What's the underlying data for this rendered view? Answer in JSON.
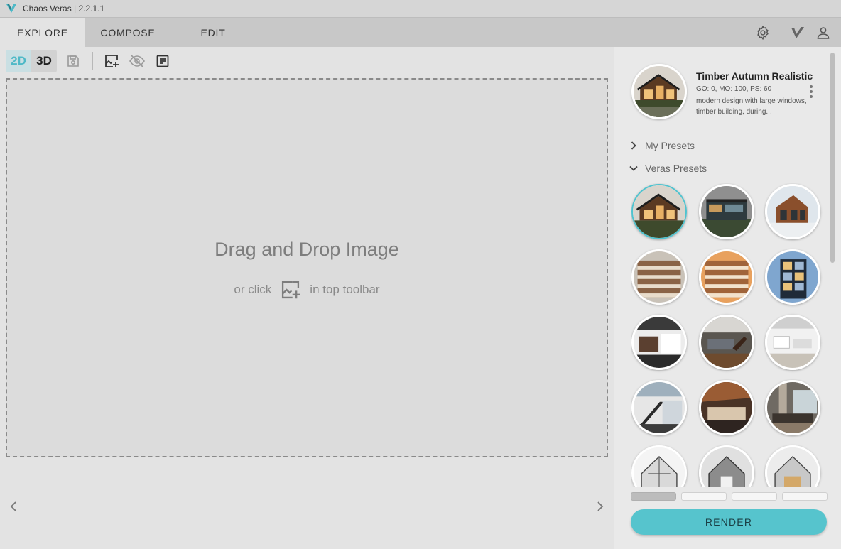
{
  "app": {
    "title": "Chaos Veras | 2.2.1.1",
    "logo_icon": "veras-logo-icon",
    "accent": "#56c4cd"
  },
  "tabs": [
    {
      "label": "EXPLORE",
      "active": true
    },
    {
      "label": "COMPOSE",
      "active": false
    },
    {
      "label": "EDIT",
      "active": false
    }
  ],
  "header_icons": [
    "gear-icon",
    "veras-check-icon",
    "user-icon"
  ],
  "toolbar": {
    "mode_2d": "2D",
    "mode_3d": "3D",
    "icons": [
      "save-icon",
      "add-image-icon",
      "eye-off-icon",
      "notes-icon"
    ]
  },
  "dropzone": {
    "title": "Drag and Drop Image",
    "sub_before": "or click",
    "sub_after": "in top toolbar"
  },
  "preset": {
    "name": "Timber Autumn Realistic",
    "params": "GO: 0, MO: 100, PS: 60",
    "description": "modern design with large windows, timber building, during..."
  },
  "sections": {
    "my_presets": "My Presets",
    "veras_presets": "Veras Presets"
  },
  "render_label": "RENDER",
  "pager": {
    "pages": 4,
    "active": 0
  }
}
